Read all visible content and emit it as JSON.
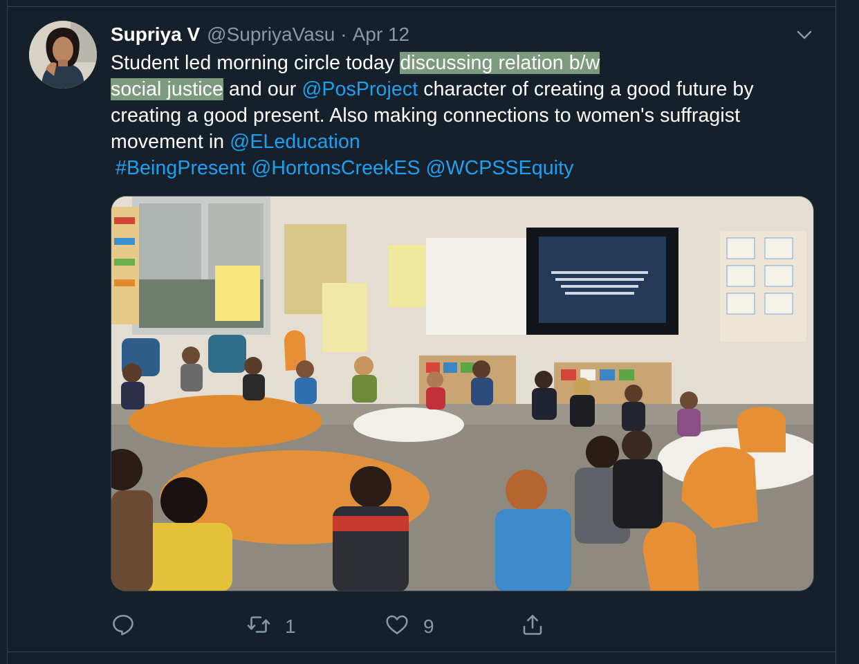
{
  "tweet": {
    "author_name": "Supriya V",
    "handle": "@SupriyaVasu",
    "separator": "·",
    "date": "Apr 12",
    "text": {
      "part1": "Student led morning circle today ",
      "highlight1": "discussing relation b/w ",
      "highlight2": "social justice",
      "part2": " and our ",
      "mention1": "@PosProject",
      "part3": " character of creating a good future by creating a good present. Also making connections to women's suffragist movement in ",
      "mention2": "@ELeducation",
      "hashtag": "#BeingPresent",
      "mention3": "@HortonsCreekES",
      "mention4": "@WCPSSEquity"
    },
    "photo_alt": "Classroom of students sitting in a morning circle"
  },
  "actions": {
    "reply_count": "",
    "retweet_count": "1",
    "like_count": "9"
  },
  "colors": {
    "background": "#15202b",
    "link": "#1da1f2",
    "muted": "#8899a6",
    "highlight": "#7b9a7e"
  },
  "icons": [
    "chevron-down-icon",
    "reply-icon",
    "retweet-icon",
    "like-icon",
    "share-icon"
  ]
}
